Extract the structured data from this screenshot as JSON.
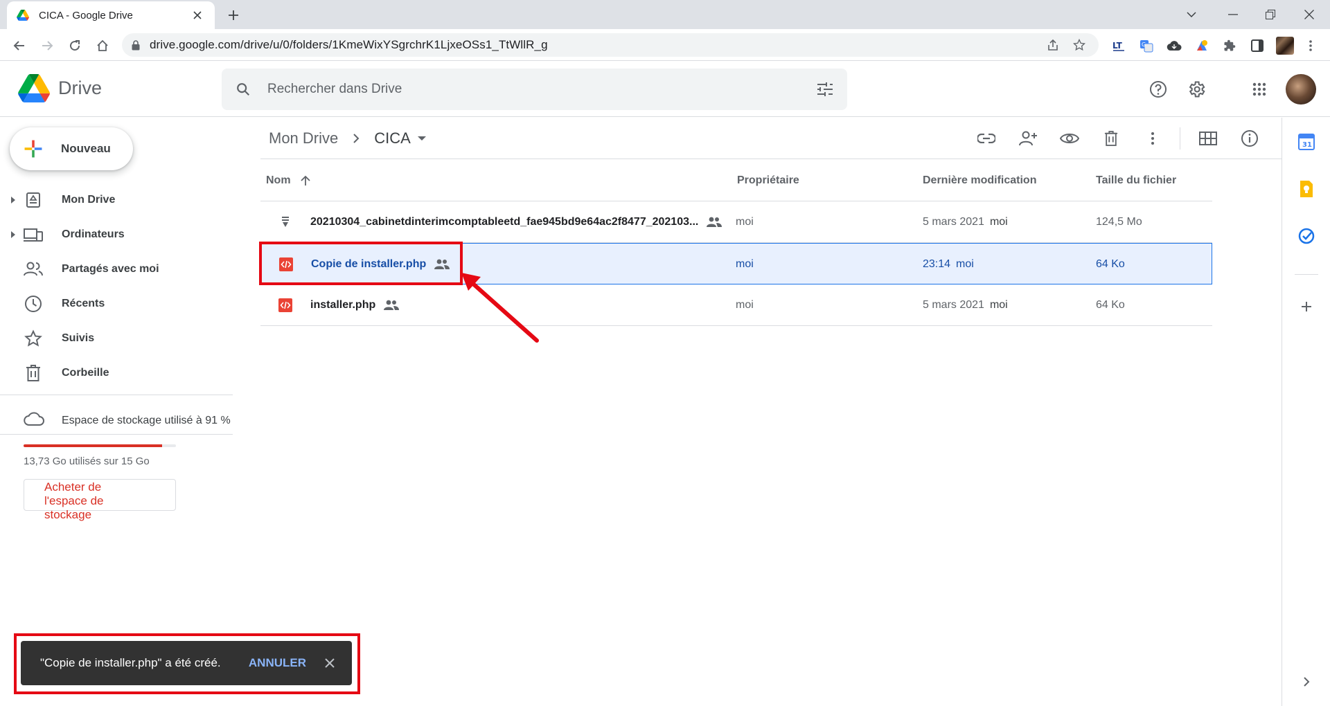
{
  "browser": {
    "tab_title": "CICA - Google Drive",
    "url": "drive.google.com/drive/u/0/folders/1KmeWixYSgrchrK1LjxeOSs1_TtWllR_g"
  },
  "drive": {
    "app_name": "Drive",
    "search_placeholder": "Rechercher dans Drive"
  },
  "sidebar": {
    "new_label": "Nouveau",
    "items": [
      {
        "label": "Mon Drive",
        "icon": "my-drive-icon",
        "expandable": true
      },
      {
        "label": "Ordinateurs",
        "icon": "computers-icon",
        "expandable": true
      },
      {
        "label": "Partagés avec moi",
        "icon": "shared-icon",
        "expandable": false
      },
      {
        "label": "Récents",
        "icon": "clock-icon",
        "expandable": false
      },
      {
        "label": "Suivis",
        "icon": "star-icon",
        "expandable": false
      },
      {
        "label": "Corbeille",
        "icon": "trash-icon",
        "expandable": false
      }
    ],
    "storage": {
      "label": "Espace de stockage utilisé à 91 %",
      "used_text": "13,73 Go utilisés sur 15 Go",
      "fraction": 0.91,
      "buy_label": "Acheter de l'espace de stockage"
    }
  },
  "breadcrumb": {
    "root": "Mon Drive",
    "current": "CICA"
  },
  "table": {
    "headers": {
      "name": "Nom",
      "owner": "Propriétaire",
      "modified": "Dernière modification",
      "size": "Taille du fichier"
    },
    "rows": [
      {
        "name": "20210304_cabinetdinterimcomptableetd_fae945bd9e64ac2f8477_202103...",
        "owner": "moi",
        "modified": "5 mars 2021",
        "modified_by": "moi",
        "size": "124,5 Mo",
        "type": "archive"
      },
      {
        "name": "Copie de installer.php",
        "owner": "moi",
        "modified": "23:14",
        "modified_by": "moi",
        "size": "64 Ko",
        "type": "code",
        "selected": true
      },
      {
        "name": "installer.php",
        "owner": "moi",
        "modified": "5 mars 2021",
        "modified_by": "moi",
        "size": "64 Ko",
        "type": "code"
      }
    ]
  },
  "snackbar": {
    "message": "\"Copie de installer.php\" a été créé.",
    "undo": "ANNULER"
  },
  "colors": {
    "accent": "#1a73e8",
    "annotation": "#e50914",
    "storage_bar": "#d93025"
  }
}
